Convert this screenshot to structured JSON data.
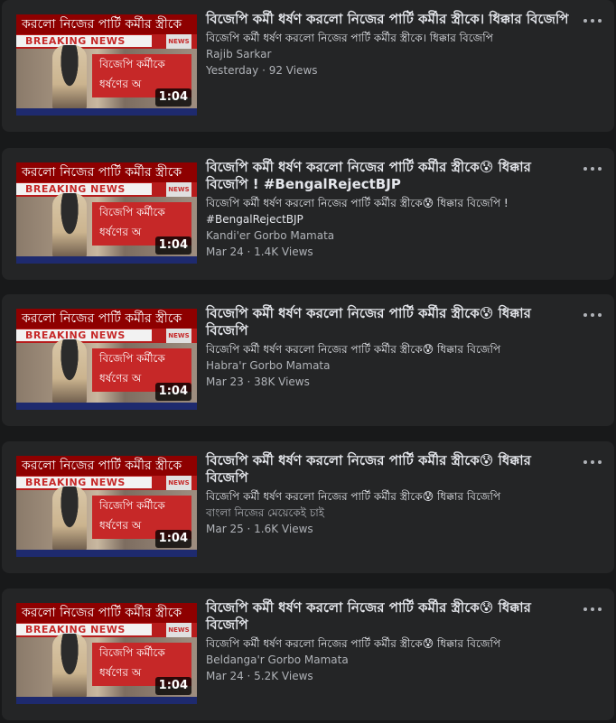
{
  "videos": [
    {
      "thumb_headline": "করলো নিজের পার্টি কর্মীর স্ত্রীকে",
      "thumb_breaking": "BREAKING NEWS",
      "thumb_logo": "NEWS",
      "thumb_caption": "বিজেপি কর্মীকে ধর্ষণের অ",
      "duration": "1:04",
      "title": "বিজেপি কর্মী ধর্ষণ করলো নিজের পার্টি কর্মীর স্ত্রীকে। ধিক্কার বিজেপি",
      "description": "বিজেপি কর্মী ধর্ষণ করলো নিজের পার্টি কর্মীর স্ত্রীকে। ধিক্কার বিজেপি",
      "channel": "Rajib Sarkar",
      "meta": "Yesterday · 92 Views"
    },
    {
      "thumb_headline": "করলো নিজের পার্টি কর্মীর স্ত্রীকে",
      "thumb_breaking": "BREAKING NEWS",
      "thumb_logo": "NEWS",
      "thumb_caption": "বিজেপি কর্মীকে ধর্ষণের অ",
      "duration": "1:04",
      "title": "বিজেপি কর্মী ধর্ষণ করলো নিজের পার্টি কর্মীর স্ত্রীকে😰 ধিক্কার বিজেপি ! #BengalRejectBJP",
      "description": "বিজেপি কর্মী ধর্ষণ করলো নিজের পার্টি কর্মীর স্ত্রীকে😰 ধিক্কার বিজেপি ! #BengalRejectBJP",
      "channel": "Kandi'er Gorbo Mamata",
      "meta": "Mar 24 · 1.4K Views"
    },
    {
      "thumb_headline": "করলো নিজের পার্টি কর্মীর স্ত্রীকে",
      "thumb_breaking": "BREAKING NEWS",
      "thumb_logo": "NEWS",
      "thumb_caption": "বিজেপি কর্মীকে ধর্ষণের অ",
      "duration": "1:04",
      "title": "বিজেপি কর্মী ধর্ষণ করলো নিজের পার্টি কর্মীর স্ত্রীকে😰 ধিক্কার বিজেপি",
      "description": "বিজেপি কর্মী ধর্ষণ করলো নিজের পার্টি কর্মীর স্ত্রীকে😰 ধিক্কার বিজেপি",
      "channel": "Habra'r Gorbo Mamata",
      "meta": "Mar 23 · 38K Views"
    },
    {
      "thumb_headline": "করলো নিজের পার্টি কর্মীর স্ত্রীকে",
      "thumb_breaking": "BREAKING NEWS",
      "thumb_logo": "NEWS",
      "thumb_caption": "বিজেপি কর্মীকে ধর্ষণের অ",
      "duration": "1:04",
      "title": "বিজেপি কর্মী ধর্ষণ করলো নিজের পার্টি কর্মীর স্ত্রীকে😰 ধিক্কার বিজেপি",
      "description": "বিজেপি কর্মী ধর্ষণ করলো নিজের পার্টি কর্মীর স্ত্রীকে😰 ধিক্কার বিজেপি",
      "channel": "বাংলা নিজের মেয়েকেই চাই",
      "meta": "Mar 25 · 1.6K Views"
    },
    {
      "thumb_headline": "করলো নিজের পার্টি কর্মীর স্ত্রীকে",
      "thumb_breaking": "BREAKING NEWS",
      "thumb_logo": "NEWS",
      "thumb_caption": "বিজেপি কর্মীকে ধর্ষণের অ",
      "duration": "1:04",
      "title": "বিজেপি কর্মী ধর্ষণ করলো নিজের পার্টি কর্মীর স্ত্রীকে😰 ধিক্কার বিজেপি",
      "description": "বিজেপি কর্মী ধর্ষণ করলো নিজের পার্টি কর্মীর স্ত্রীকে😰 ধিক্কার বিজেপি",
      "channel": "Beldanga'r Gorbo Mamata",
      "meta": "Mar 24 · 5.2K Views"
    }
  ],
  "more_icon": "more-horizontal-icon"
}
